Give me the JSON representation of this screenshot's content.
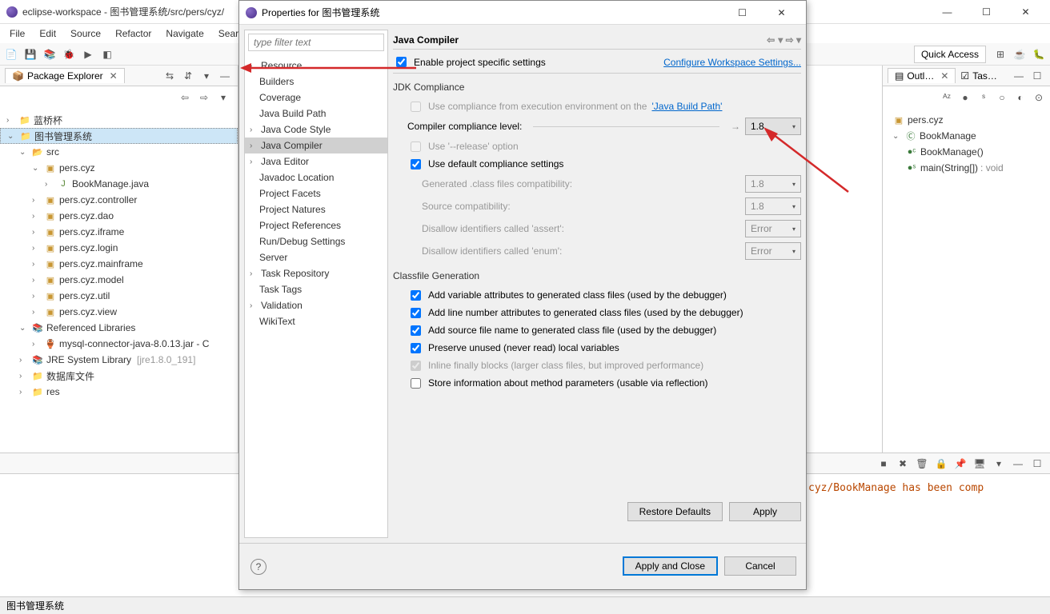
{
  "main": {
    "title": "eclipse-workspace - 图书管理系统/src/pers/cyz/",
    "menus": [
      "File",
      "Edit",
      "Source",
      "Refactor",
      "Navigate",
      "Search"
    ],
    "quick_access": "Quick Access"
  },
  "package_explorer": {
    "title": "Package Explorer",
    "tree": {
      "p1": "蓝桥杯",
      "p2": "图书管理系统",
      "src": "src",
      "pkg1": "pers.cyz",
      "file1": "BookManage.java",
      "pkg2": "pers.cyz.controller",
      "pkg3": "pers.cyz.dao",
      "pkg4": "pers.cyz.iframe",
      "pkg5": "pers.cyz.login",
      "pkg6": "pers.cyz.mainframe",
      "pkg7": "pers.cyz.model",
      "pkg8": "pers.cyz.util",
      "pkg9": "pers.cyz.view",
      "ref": "Referenced Libraries",
      "jar": "mysql-connector-java-8.0.13.jar - C",
      "jre": "JRE System Library",
      "jre_ver": "[jre1.8.0_191]",
      "db": "数据库文件",
      "res": "res"
    }
  },
  "outline": {
    "title": "Outl…",
    "tasks": "Tas…",
    "pkg": "pers.cyz",
    "cls": "BookManage",
    "m1": "BookManage()",
    "m2_name": "main(String[])",
    "m2_ret": " : void"
  },
  "dialog": {
    "title": "Properties for 图书管理系统",
    "filter": "type filter text",
    "tree": {
      "resource": "Resource",
      "builders": "Builders",
      "coverage": "Coverage",
      "jbp": "Java Build Path",
      "jcs": "Java Code Style",
      "jc": "Java Compiler",
      "je": "Java Editor",
      "jl": "Javadoc Location",
      "pf": "Project Facets",
      "pn": "Project Natures",
      "pr": "Project References",
      "rds": "Run/Debug Settings",
      "server": "Server",
      "tr": "Task Repository",
      "tt": "Task Tags",
      "val": "Validation",
      "wiki": "WikiText"
    },
    "header": "Java Compiler",
    "enable": "Enable project specific settings",
    "config_ws": "Configure Workspace Settings...",
    "jdk_section": "JDK Compliance",
    "use_exec_env": "Use compliance from execution environment on the ",
    "jbp_link": "'Java Build Path'",
    "ccl": "Compiler compliance level:",
    "ccl_val": "1.8",
    "release": "Use '--release' option",
    "use_default": "Use default compliance settings",
    "gen_compat": "Generated .class files compatibility:",
    "gen_compat_val": "1.8",
    "src_compat": "Source compatibility:",
    "src_compat_val": "1.8",
    "assert": "Disallow identifiers called 'assert':",
    "assert_val": "Error",
    "enum": "Disallow identifiers called 'enum':",
    "enum_val": "Error",
    "classfile_section": "Classfile Generation",
    "cf1": "Add variable attributes to generated class files (used by the debugger)",
    "cf2": "Add line number attributes to generated class files (used by the debugger)",
    "cf3": "Add source file name to generated class file (used by the debugger)",
    "cf4": "Preserve unused (never read) local variables",
    "cf5": "Inline finally blocks (larger class files, but improved performance)",
    "cf6": "Store information about method parameters (usable via reflection)",
    "restore": "Restore Defaults",
    "apply": "Apply",
    "apply_close": "Apply and Close",
    "cancel": "Cancel"
  },
  "console": {
    "text": "cyz/BookManage has been comp"
  },
  "status": "图书管理系统"
}
